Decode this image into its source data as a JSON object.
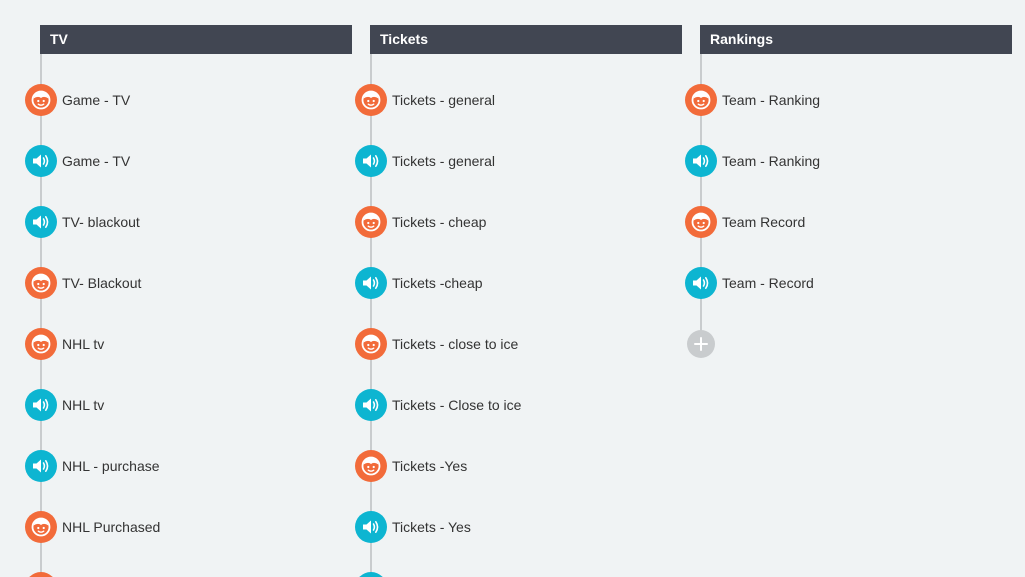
{
  "columns": [
    {
      "title": "TV",
      "items": [
        {
          "label": "Game - TV",
          "kind": "user"
        },
        {
          "label": "Game - TV",
          "kind": "bot"
        },
        {
          "label": "TV- blackout",
          "kind": "bot"
        },
        {
          "label": "TV- Blackout",
          "kind": "user"
        },
        {
          "label": "NHL tv",
          "kind": "user"
        },
        {
          "label": "NHL tv",
          "kind": "bot"
        },
        {
          "label": "NHL - purchase",
          "kind": "bot"
        },
        {
          "label": "NHL Purchased",
          "kind": "user"
        }
      ]
    },
    {
      "title": "Tickets",
      "items": [
        {
          "label": "Tickets - general",
          "kind": "user"
        },
        {
          "label": "Tickets - general",
          "kind": "bot"
        },
        {
          "label": "Tickets - cheap",
          "kind": "user"
        },
        {
          "label": "Tickets -cheap",
          "kind": "bot"
        },
        {
          "label": "Tickets - close to ice",
          "kind": "user"
        },
        {
          "label": "Tickets - Close to ice",
          "kind": "bot"
        },
        {
          "label": "Tickets -Yes",
          "kind": "user"
        },
        {
          "label": "Tickets - Yes",
          "kind": "bot"
        }
      ]
    },
    {
      "title": "Rankings",
      "items": [
        {
          "label": "Team - Ranking",
          "kind": "user"
        },
        {
          "label": "Team - Ranking",
          "kind": "bot"
        },
        {
          "label": "Team Record",
          "kind": "user"
        },
        {
          "label": "Team - Record",
          "kind": "bot"
        }
      ]
    }
  ],
  "colors": {
    "header_bg": "#414652",
    "user_badge": "#f26b3a",
    "bot_badge": "#0db5d1",
    "line": "#c9ccce"
  },
  "icons": {
    "user": "user-face-icon",
    "bot": "speaker-icon",
    "add": "plus-icon"
  }
}
